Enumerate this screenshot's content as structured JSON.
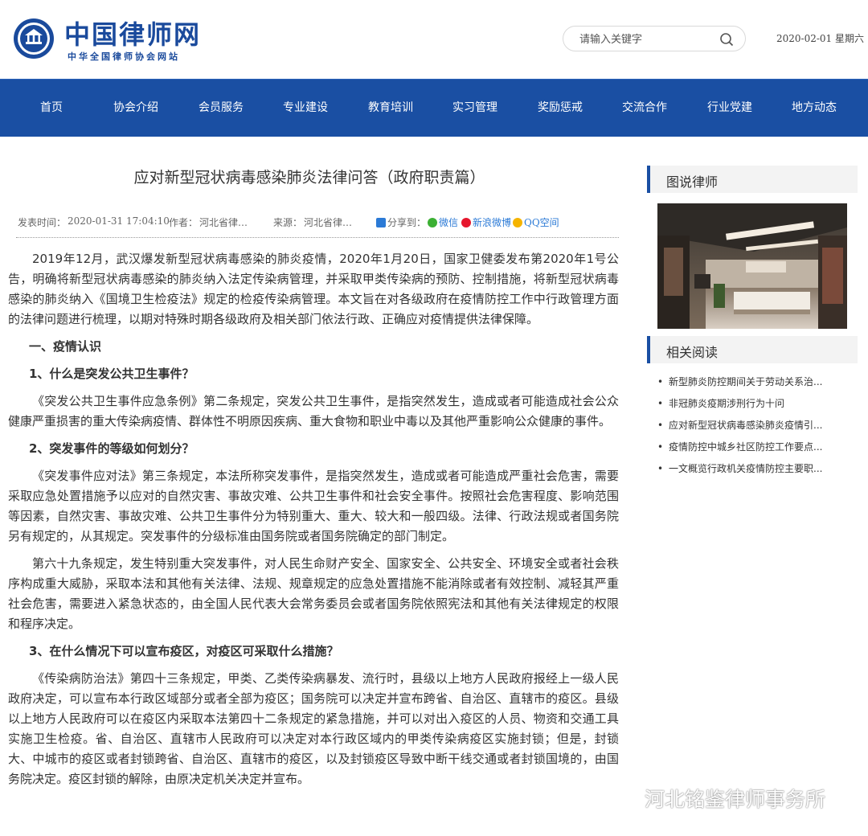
{
  "header": {
    "logo_title": "中国律师网",
    "logo_subtitle": "中华全国律师协会网站",
    "search_placeholder": "请输入关键字",
    "date": "2020-02-01 星期六"
  },
  "nav": {
    "items": [
      "首页",
      "协会介绍",
      "会员服务",
      "专业建设",
      "教育培训",
      "实习管理",
      "奖励惩戒",
      "交流合作",
      "行业党建",
      "地方动态"
    ]
  },
  "article": {
    "title": "应对新型冠状病毒感染肺炎法律问答（政府职责篇）",
    "meta": {
      "published_label": "发表时间：",
      "published": "2020-01-31 17:04:10",
      "author_label": "作者：",
      "author": "河北省律…",
      "source_label": "来源：",
      "source": "河北省律…",
      "share_label": "分享到：",
      "share_wechat": "微信",
      "share_weibo": "新浪微博",
      "share_qq": "QQ空间"
    },
    "p1": "2019年12月，武汉爆发新型冠状病毒感染的肺炎疫情，2020年1月20日，国家卫健委发布第2020年1号公告，明确将新型冠状病毒感染的肺炎纳入法定传染病管理，并采取甲类传染病的预防、控制措施，将新型冠状病毒感染的肺炎纳入《国境卫生检疫法》规定的检疫传染病管理。本文旨在对各级政府在疫情防控工作中行政管理方面的法律问题进行梳理，以期对特殊时期各级政府及相关部门依法行政、正确应对疫情提供法律保障。",
    "h_section1": "一、疫情认识",
    "q1": "1、什么是突发公共卫生事件？",
    "p2": "《突发公共卫生事件应急条例》第二条规定，突发公共卫生事件，是指突然发生，造成或者可能造成社会公众健康严重损害的重大传染病疫情、群体性不明原因疾病、重大食物和职业中毒以及其他严重影响公众健康的事件。",
    "q2": "2、突发事件的等级如何划分？",
    "p3": "《突发事件应对法》第三条规定，本法所称突发事件，是指突然发生，造成或者可能造成严重社会危害，需要采取应急处置措施予以应对的自然灾害、事故灾难、公共卫生事件和社会安全事件。按照社会危害程度、影响范围等因素，自然灾害、事故灾难、公共卫生事件分为特别重大、重大、较大和一般四级。法律、行政法规或者国务院另有规定的，从其规定。突发事件的分级标准由国务院或者国务院确定的部门制定。",
    "p4": "第六十九条规定，发生特别重大突发事件，对人民生命财产安全、国家安全、公共安全、环境安全或者社会秩序构成重大威胁，采取本法和其他有关法律、法规、规章规定的应急处置措施不能消除或者有效控制、减轻其严重社会危害，需要进入紧急状态的，由全国人民代表大会常务委员会或者国务院依照宪法和其他有关法律规定的权限和程序决定。",
    "q3": "3、在什么情况下可以宣布疫区，对疫区可采取什么措施？",
    "p5": "《传染病防治法》第四十三条规定，甲类、乙类传染病暴发、流行时，县级以上地方人民政府报经上一级人民政府决定，可以宣布本行政区域部分或者全部为疫区；国务院可以决定并宣布跨省、自治区、直辖市的疫区。县级以上地方人民政府可以在疫区内采取本法第四十二条规定的紧急措施，并可以对出入疫区的人员、物资和交通工具实施卫生检疫。省、自治区、直辖市人民政府可以决定对本行政区域内的甲类传染病疫区实施封锁；但是，封锁大、中城市的疫区或者封锁跨省、自治区、直辖市的疫区，以及封锁疫区导致中断干线交通或者封锁国境的，由国务院决定。疫区封锁的解除，由原决定机关决定并宣布。"
  },
  "sidebar": {
    "photo_heading": "图说律师",
    "related_heading": "相关阅读",
    "related": [
      "新型肺炎防控期间关于劳动关系治...",
      "非冠肺炎疫期涉刑行为十问",
      "应对新型冠状病毒感染肺炎疫情引...",
      "疫情防控中城乡社区防控工作要点...",
      "一文概览行政机关疫情防控主要职..."
    ]
  },
  "watermark": "河北铭鉴律师事务所"
}
